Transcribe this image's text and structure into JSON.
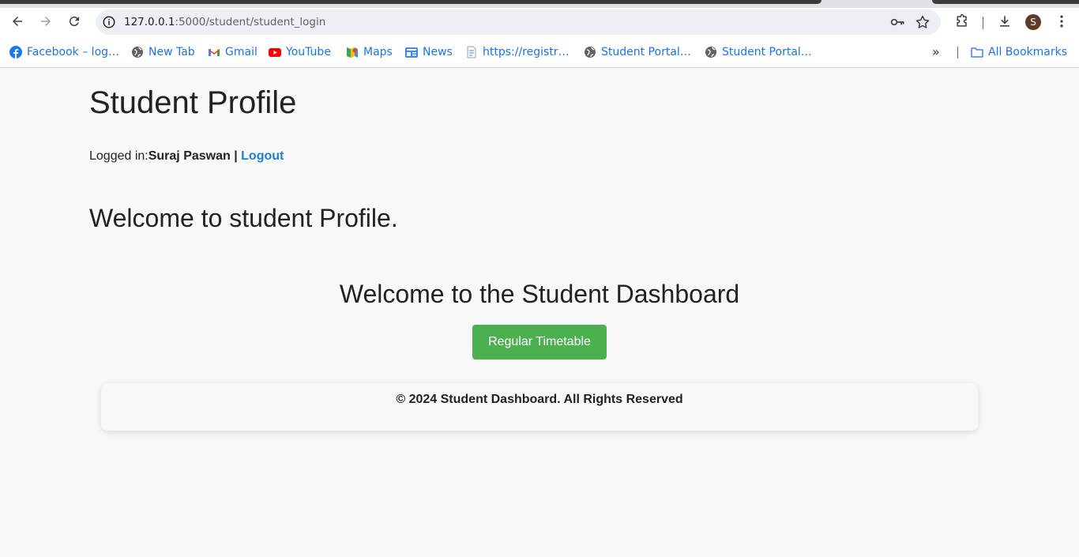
{
  "browser": {
    "url_host": "127.0.0.1",
    "url_path": ":5000/student/student_login",
    "avatar_letter": "S",
    "bookmarks": [
      {
        "label": "Facebook – log…",
        "icon": "facebook-icon"
      },
      {
        "label": "New Tab",
        "icon": "globe-icon"
      },
      {
        "label": "Gmail",
        "icon": "gmail-icon"
      },
      {
        "label": "YouTube",
        "icon": "youtube-icon"
      },
      {
        "label": "Maps",
        "icon": "maps-icon"
      },
      {
        "label": "News",
        "icon": "news-icon"
      },
      {
        "label": "https://registr…",
        "icon": "document-icon"
      },
      {
        "label": "Student Portal…",
        "icon": "globe-icon"
      },
      {
        "label": "Student Portal…",
        "icon": "globe-icon"
      }
    ],
    "more_bookmarks": "»",
    "all_bookmarks": "All Bookmarks"
  },
  "page": {
    "title": "Student Profile",
    "logged_prefix": "Logged in:",
    "user_name": "Suraj Paswan",
    "separator": " | ",
    "logout_label": "Logout",
    "welcome_profile": "Welcome to student Profile.",
    "dashboard_title": "Welcome to the Student Dashboard",
    "timetable_button": "Regular Timetable",
    "footer_text": "© 2024 Student Dashboard. All Rights Reserved"
  },
  "colors": {
    "button_green": "#4caf50",
    "link_blue": "#1e7fd8",
    "page_bg": "#f8f8f8"
  }
}
